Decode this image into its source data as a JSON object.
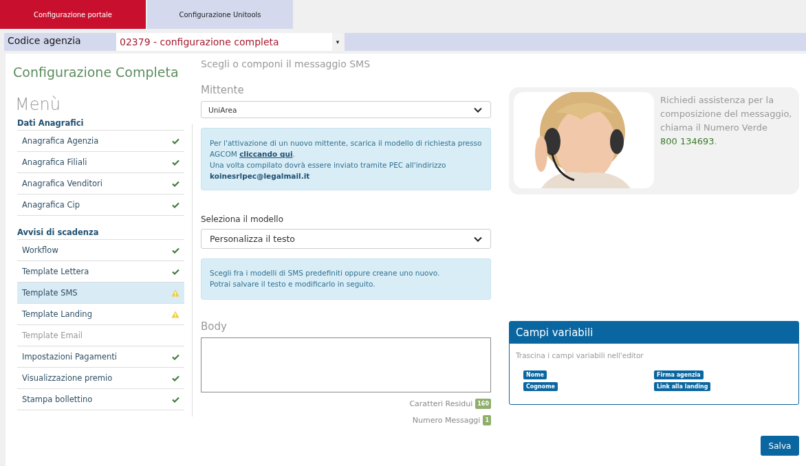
{
  "tabs": [
    {
      "label": "Configurazione portale",
      "selected": true
    },
    {
      "label": "Configurazione Unitools",
      "selected": false
    }
  ],
  "agency": {
    "label": "Codice agenzia",
    "value": "02379 - configurazione completa",
    "caret": "▾"
  },
  "sidebar": {
    "title": "Configurazione Completa",
    "menu_title": "Menù",
    "sections": [
      {
        "heading": "Dati Anagrafici",
        "items": [
          {
            "label": "Anagrafica Agenzia",
            "kind": "done",
            "selected": false
          },
          {
            "label": "Anagrafica Filiali",
            "kind": "done",
            "selected": false
          },
          {
            "label": "Anagrafica Venditori",
            "kind": "done",
            "selected": false
          },
          {
            "label": "Anagrafica Cip",
            "kind": "done",
            "selected": false
          }
        ]
      },
      {
        "heading": "Avvisi di scadenza",
        "items": [
          {
            "label": "Workflow",
            "kind": "done",
            "selected": false
          },
          {
            "label": "Template Lettera",
            "kind": "done",
            "selected": false
          },
          {
            "label": "Template SMS",
            "kind": "warning",
            "selected": true
          },
          {
            "label": "Template Landing",
            "kind": "warning",
            "selected": false
          },
          {
            "label": "Template Email",
            "kind": "inactive",
            "selected": false
          },
          {
            "label": "Impostazioni Pagamenti",
            "kind": "done",
            "selected": false
          },
          {
            "label": "Visualizzazione premio",
            "kind": "done",
            "selected": false
          },
          {
            "label": "Stampa bollettino",
            "kind": "done",
            "selected": false
          }
        ]
      }
    ]
  },
  "form": {
    "title": "Scegli o componi il messaggio SMS",
    "sender": {
      "label": "Mittente",
      "value": "UniArea"
    },
    "sender_info": {
      "before": "Per l'attivazione di un nuovo mittente, scarica il modello di richiesta presso AGCOM",
      "link": "cliccando qui",
      "after": ".",
      "second": "Una volta compilato dovrà essere inviato tramite PEC all'indirizzo **koinesrlpec@legalmail.it**"
    },
    "model": {
      "label": "Seleziona il modello",
      "value": "Personalizza il testo"
    },
    "model_info": [
      "Scegli fra i modelli di SMS predefiniti oppure creane uno nuovo.",
      "Potrai salvare il testo e modificarlo in seguito."
    ],
    "body": {
      "label": "Body"
    },
    "counters": [
      {
        "label": "Caratteri Residui",
        "value": "160"
      },
      {
        "label": "Numero Messaggi",
        "value": "1"
      }
    ]
  },
  "help": {
    "kind": "picture",
    "text": "Richiedi assistenza per la composizione del messaggio, chiama il Numero Verde",
    "phone": "800 134693",
    "after": "."
  },
  "variables": {
    "title": "Campi variabili",
    "hint": "Trascina i campi variabili nell'editor",
    "tags": [
      "Nome",
      "Firma agenzia",
      "Cognome",
      "Link alla landing"
    ]
  },
  "save_button": "Salva"
}
